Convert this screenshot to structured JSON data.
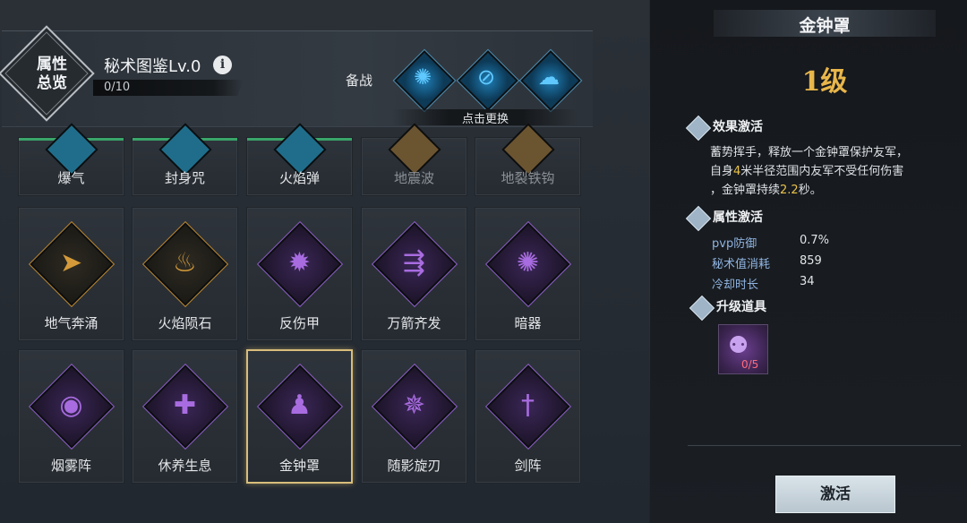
{
  "header": {
    "emblem_text": "属性\n总览",
    "title": "秘术图鉴Lv.0",
    "info_icon": "info-icon",
    "progress": "0/10",
    "reserve_label": "备战",
    "hint": "点击更换",
    "slots": [
      {
        "icon": "lightning-orb-icon"
      },
      {
        "icon": "ward-rune-icon"
      },
      {
        "icon": "spirit-wisp-icon"
      }
    ]
  },
  "top_row": [
    {
      "label": "爆气",
      "dim": false
    },
    {
      "label": "封身咒",
      "dim": false
    },
    {
      "label": "火焰弹",
      "dim": false
    },
    {
      "label": "地震波",
      "dim": true
    },
    {
      "label": "地裂铁钩",
      "dim": true
    }
  ],
  "middle_row": [
    {
      "label": "地气奔涌",
      "color": "#b8852e",
      "glyph": "➤"
    },
    {
      "label": "火焰陨石",
      "color": "#b8852e",
      "glyph": "♨"
    },
    {
      "label": "反伤甲",
      "color": "#6d3fa0",
      "glyph": "✹"
    },
    {
      "label": "万箭齐发",
      "color": "#6d3fa0",
      "glyph": "⇶"
    },
    {
      "label": "暗器",
      "color": "#6d3fa0",
      "glyph": "✺"
    }
  ],
  "bottom_row": [
    {
      "label": "烟雾阵",
      "color": "#6d3fa0",
      "glyph": "◉"
    },
    {
      "label": "休养生息",
      "color": "#6d3fa0",
      "glyph": "✚"
    },
    {
      "label": "金钟罩",
      "color": "#6d3fa0",
      "glyph": "♟",
      "selected": true
    },
    {
      "label": "随影旋刃",
      "color": "#6d3fa0",
      "glyph": "✵"
    },
    {
      "label": "剑阵",
      "color": "#6d3fa0",
      "glyph": "†"
    }
  ],
  "detail": {
    "name": "金钟罩",
    "level": "1级",
    "effect_title": "效果激活",
    "effect_line1": "蓄势挥手，释放一个金钟罩保护友军，",
    "effect_line2_a": "自身",
    "effect_line2_num": "4",
    "effect_line2_b": "米半径范围内友军不受任何伤害",
    "effect_line3_a": "，金钟罩持续",
    "effect_line3_num": "2.2",
    "effect_line3_b": "秒。",
    "attr_title": "属性激活",
    "stats": [
      {
        "name": "pvp防御",
        "value": "0.7%"
      },
      {
        "name": "秘术值消耗",
        "value": "859"
      },
      {
        "name": "冷却时长",
        "value": "34"
      }
    ],
    "upgrade_title": "升级道具",
    "item_count": "0/5",
    "activate_label": "激活"
  },
  "colors": {
    "accent_gold": "#e8b64a",
    "selected_border": "#d8bd7a",
    "stat_name": "#8fb3e0"
  }
}
